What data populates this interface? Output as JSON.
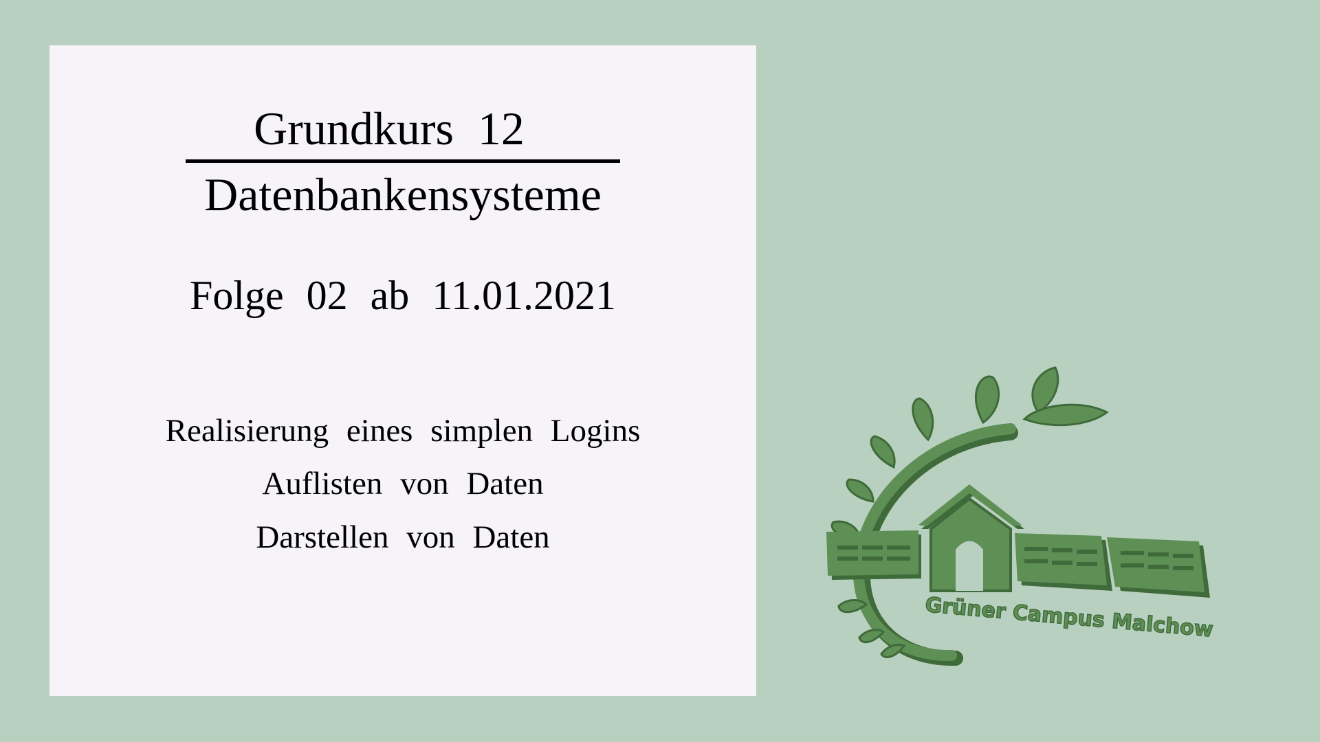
{
  "slide": {
    "course_title": "Grundkurs  12",
    "subject": "Datenbankensysteme",
    "episode": "Folge  02  ab  11.01.2021",
    "topics": [
      "Realisierung  eines  simplen  Logins",
      "Auflisten  von  Daten",
      "Darstellen  von  Daten"
    ]
  },
  "logo": {
    "text": "Grüner Campus Malchow",
    "icon": "green-campus-house-sun-logo"
  },
  "colors": {
    "background": "#b8d0bf",
    "card": "#f6f3f9",
    "logo_green": "#5e8f55",
    "logo_dark": "#3f6a3a"
  }
}
